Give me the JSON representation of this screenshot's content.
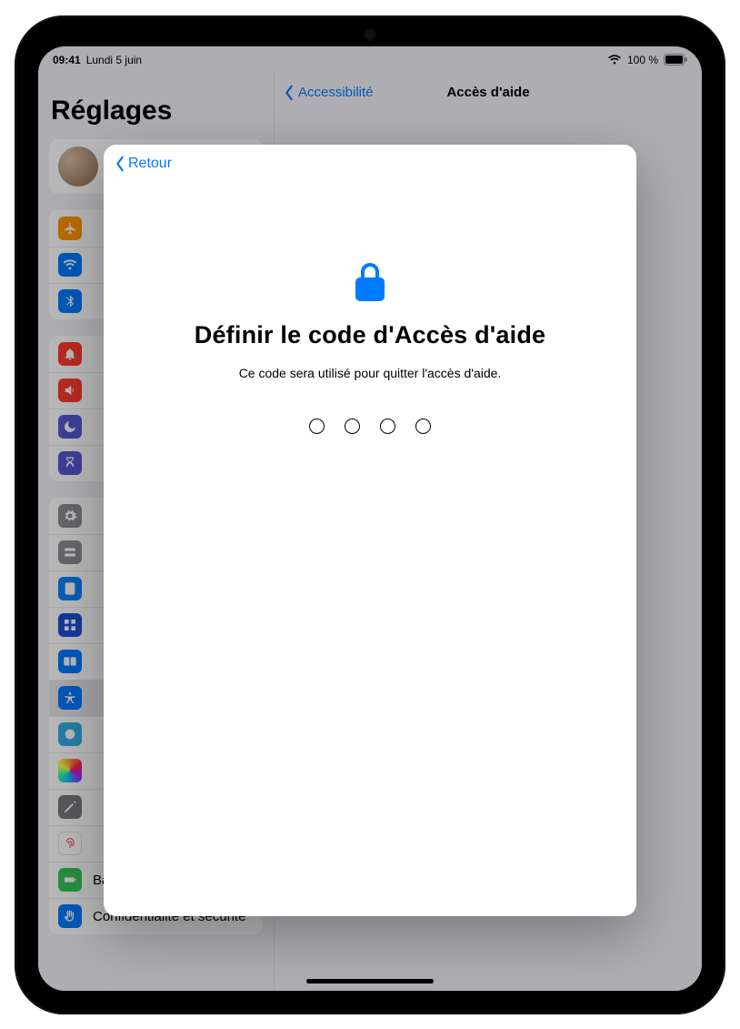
{
  "status": {
    "time": "09:41",
    "date": "Lundi 5 juin",
    "battery_text": "100 %"
  },
  "sidebar": {
    "title": "Réglages",
    "items": {
      "battery": "Batterie",
      "privacy": "Confidentialité et sécurité"
    }
  },
  "detail": {
    "back_label": "Accessibilité",
    "title": "Accès d'aide"
  },
  "modal": {
    "back_label": "Retour",
    "title": "Définir le code d'Accès d'aide",
    "subtitle": "Ce code sera utilisé pour quitter l'accès d'aide."
  }
}
